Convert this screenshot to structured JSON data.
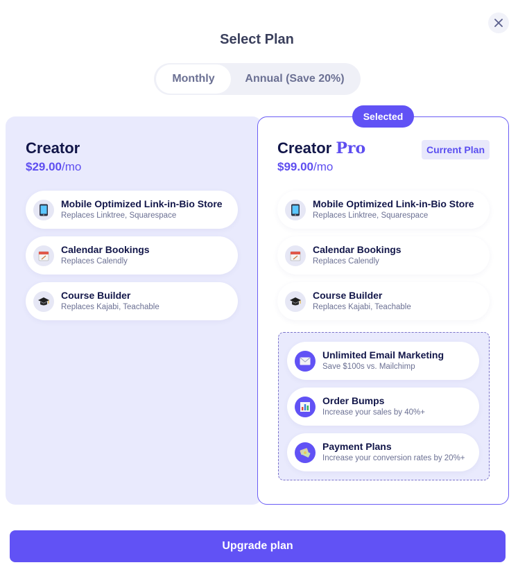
{
  "modal": {
    "title": "Select Plan",
    "close_icon": "close-icon",
    "billing_toggle": {
      "options": [
        "Monthly",
        "Annual (Save 20%)"
      ],
      "selected": "Monthly"
    },
    "plans": [
      {
        "name": "Creator",
        "name_suffix": "",
        "price": "$29.00",
        "period": "/mo",
        "features": [
          {
            "icon": "phone-icon",
            "title": "Mobile Optimized Link-in-Bio Store",
            "subtitle": "Replaces Linktree, Squarespace"
          },
          {
            "icon": "calendar-icon",
            "title": "Calendar Bookings",
            "subtitle": "Replaces Calendly"
          },
          {
            "icon": "graduation-cap-icon",
            "title": "Course Builder",
            "subtitle": "Replaces Kajabi, Teachable"
          }
        ]
      },
      {
        "name": "Creator",
        "name_suffix": "Pro",
        "price": "$99.00",
        "period": "/mo",
        "badge": "Selected",
        "tag": "Current Plan",
        "features": [
          {
            "icon": "phone-icon",
            "title": "Mobile Optimized Link-in-Bio Store",
            "subtitle": "Replaces Linktree, Squarespace"
          },
          {
            "icon": "calendar-icon",
            "title": "Calendar Bookings",
            "subtitle": "Replaces Calendly"
          },
          {
            "icon": "graduation-cap-icon",
            "title": "Course Builder",
            "subtitle": "Replaces Kajabi, Teachable"
          }
        ],
        "extra_features": [
          {
            "icon": "envelope-icon",
            "title": "Unlimited Email Marketing",
            "subtitle": "Save $100s vs. Mailchimp"
          },
          {
            "icon": "bar-chart-icon",
            "title": "Order Bumps",
            "subtitle": "Increase your sales by 40%+"
          },
          {
            "icon": "money-icon",
            "title": "Payment Plans",
            "subtitle": "Increase your conversion rates by 20%+"
          }
        ]
      }
    ],
    "cta": "Upgrade plan"
  },
  "colors": {
    "accent": "#6152f5",
    "heading": "#121649",
    "muted": "#6b7093",
    "panel": "#e9eafd"
  }
}
